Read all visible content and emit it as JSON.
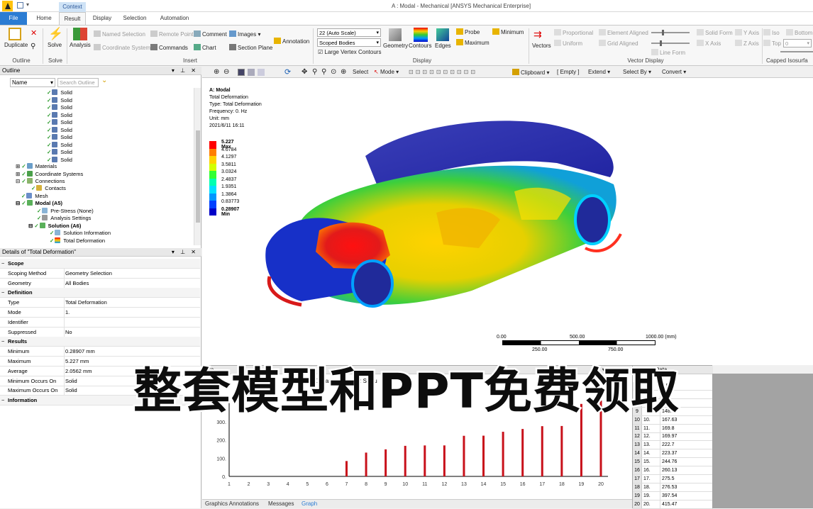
{
  "window": {
    "title": "A : Modal - Mechanical [ANSYS Mechanical Enterprise]",
    "context_tab": "Context"
  },
  "tabs": [
    "File",
    "Result",
    "Display",
    "Selection",
    "Automation"
  ],
  "ribbon": {
    "duplicate": "Duplicate",
    "outline_group": "Outline",
    "solve": "Solve",
    "solve_group": "Solve",
    "analysis": "Analysis",
    "named_selection": "Named Selection",
    "remote_point": "Remote Point",
    "comment": "Comment",
    "images": "Images",
    "coordinate_system": "Coordinate System",
    "commands": "Commands",
    "chart": "Chart",
    "section_plane": "Section Plane",
    "annotation": "Annotation",
    "insert_group": "Insert",
    "scale_combo": "22 (Auto Scale)",
    "bodies_combo": "Scoped Bodies",
    "large_vertex": "Large Vertex Contours",
    "geometry": "Geometry",
    "contours": "Contours",
    "edges": "Edges",
    "display_group": "Display",
    "probe": "Probe",
    "minimum": "Minimum",
    "maximum": "Maximum",
    "vectors": "Vectors",
    "proportional": "Proportional",
    "uniform": "Uniform",
    "element_aligned": "Element Aligned",
    "grid_aligned": "Grid Aligned",
    "line_form": "Line Form",
    "solid_form": "Solid Form",
    "x_axis": "X Axis",
    "y_axis": "Y Axis",
    "z_axis": "Z Axis",
    "vector_group": "Vector Display",
    "iso": "Iso",
    "bottom": "Bottom",
    "top": "Top",
    "top_value": "0",
    "capped_group": "Capped Isosurfa"
  },
  "outline": {
    "title": "Outline",
    "name_col": "Name",
    "search_placeholder": "Search Outline",
    "solids": [
      "Solid",
      "Solid",
      "Solid",
      "Solid",
      "Solid",
      "Solid",
      "Solid",
      "Solid",
      "Solid",
      "Solid"
    ],
    "materials": "Materials",
    "coordinate_systems": "Coordinate Systems",
    "connections": "Connections",
    "contacts": "Contacts",
    "mesh": "Mesh",
    "modal": "Modal (A5)",
    "prestress": "Pre-Stress (None)",
    "analysis_settings": "Analysis Settings",
    "solution": "Solution (A6)",
    "solution_info": "Solution Information",
    "total_deformation": "Total Deformation"
  },
  "details": {
    "title": "Details of \"Total Deformation\"",
    "rows": [
      {
        "k": "Scope",
        "v": "",
        "sec": true
      },
      {
        "k": "Scoping Method",
        "v": "Geometry Selection"
      },
      {
        "k": "Geometry",
        "v": "All Bodies"
      },
      {
        "k": "Definition",
        "v": "",
        "sec": true
      },
      {
        "k": "Type",
        "v": "Total Deformation"
      },
      {
        "k": "Mode",
        "v": "1."
      },
      {
        "k": "Identifier",
        "v": ""
      },
      {
        "k": "Suppressed",
        "v": "No"
      },
      {
        "k": "Results",
        "v": "",
        "sec": true
      },
      {
        "k": "Minimum",
        "v": "0.28907 mm"
      },
      {
        "k": "Maximum",
        "v": "5.227 mm"
      },
      {
        "k": "Average",
        "v": "2.0562 mm"
      },
      {
        "k": "Minimum Occurs On",
        "v": "Solid"
      },
      {
        "k": "Maximum Occurs On",
        "v": "Solid"
      },
      {
        "k": "Information",
        "v": "",
        "sec": true
      }
    ]
  },
  "viewtoolbar": {
    "select": "Select",
    "mode": "Mode",
    "clipboard": "Clipboard",
    "empty": "[ Empty ]",
    "extend": "Extend",
    "select_by": "Select By",
    "convert": "Convert"
  },
  "result": {
    "title": "A: Modal",
    "type1": "Total Deformation",
    "type2": "Type: Total Deformation",
    "freq": "Frequency: 0. Hz",
    "unit": "Unit: mm",
    "date": "2021/6/11 16:11"
  },
  "legend": {
    "labels": [
      "5.227 Max",
      "4.6784",
      "4.1297",
      "3.5811",
      "3.0324",
      "2.4837",
      "1.9351",
      "1.3864",
      "0.83773",
      "0.28907 Min"
    ],
    "colors": [
      "#ff0000",
      "#ff7f00",
      "#ffd200",
      "#d2ff00",
      "#33ff33",
      "#00ffb0",
      "#00e0ff",
      "#0096ff",
      "#0040ff",
      "#0000c8"
    ]
  },
  "scale": {
    "top": [
      "0.00",
      "500.00",
      "1000.00 (mm)"
    ],
    "bottom": [
      "250.00",
      "750.00"
    ]
  },
  "graph": {
    "title": "Gra",
    "frames": "20 Fram",
    "auto": "2 S (Au",
    "tabs": [
      "Graphics Annotations",
      "Messages",
      "Graph"
    ]
  },
  "chart_data": {
    "type": "bar",
    "categories": [
      "1",
      "2",
      "3",
      "4",
      "5",
      "6",
      "7",
      "8",
      "9",
      "10",
      "11",
      "12",
      "13",
      "14",
      "15",
      "16",
      "17",
      "18",
      "19",
      "20"
    ],
    "values": [
      0,
      0,
      0,
      0,
      0,
      0,
      84.2,
      130.5,
      148.3,
      167.63,
      169.8,
      169.97,
      222.7,
      223.37,
      244.76,
      260.13,
      275.5,
      276.53,
      397.54,
      415.47
    ],
    "yticks": [
      "0.",
      "100.",
      "200.",
      "300."
    ],
    "ylim": [
      0,
      420
    ]
  },
  "tabular": {
    "title": "Tabular Data",
    "rows": [
      {
        "a": "",
        "b": "",
        "c": "3.58"
      },
      {
        "a": "",
        "b": "",
        "c": "80.8"
      },
      {
        "a": "",
        "b": "",
        "c": "128."
      },
      {
        "a": "9",
        "b": "",
        "c": "148.3"
      },
      {
        "a": "10",
        "b": "10.",
        "c": "167.63"
      },
      {
        "a": "11",
        "b": "11.",
        "c": "169.8"
      },
      {
        "a": "12",
        "b": "12.",
        "c": "169.97"
      },
      {
        "a": "13",
        "b": "13.",
        "c": "222.7"
      },
      {
        "a": "14",
        "b": "14.",
        "c": "223.37"
      },
      {
        "a": "15",
        "b": "15.",
        "c": "244.76"
      },
      {
        "a": "16",
        "b": "16.",
        "c": "260.13"
      },
      {
        "a": "17",
        "b": "17.",
        "c": "275.5"
      },
      {
        "a": "18",
        "b": "18.",
        "c": "276.53"
      },
      {
        "a": "19",
        "b": "19.",
        "c": "397.54"
      },
      {
        "a": "20",
        "b": "20.",
        "c": "415.47"
      }
    ]
  },
  "banner": "整套模型和PPT免费领取"
}
